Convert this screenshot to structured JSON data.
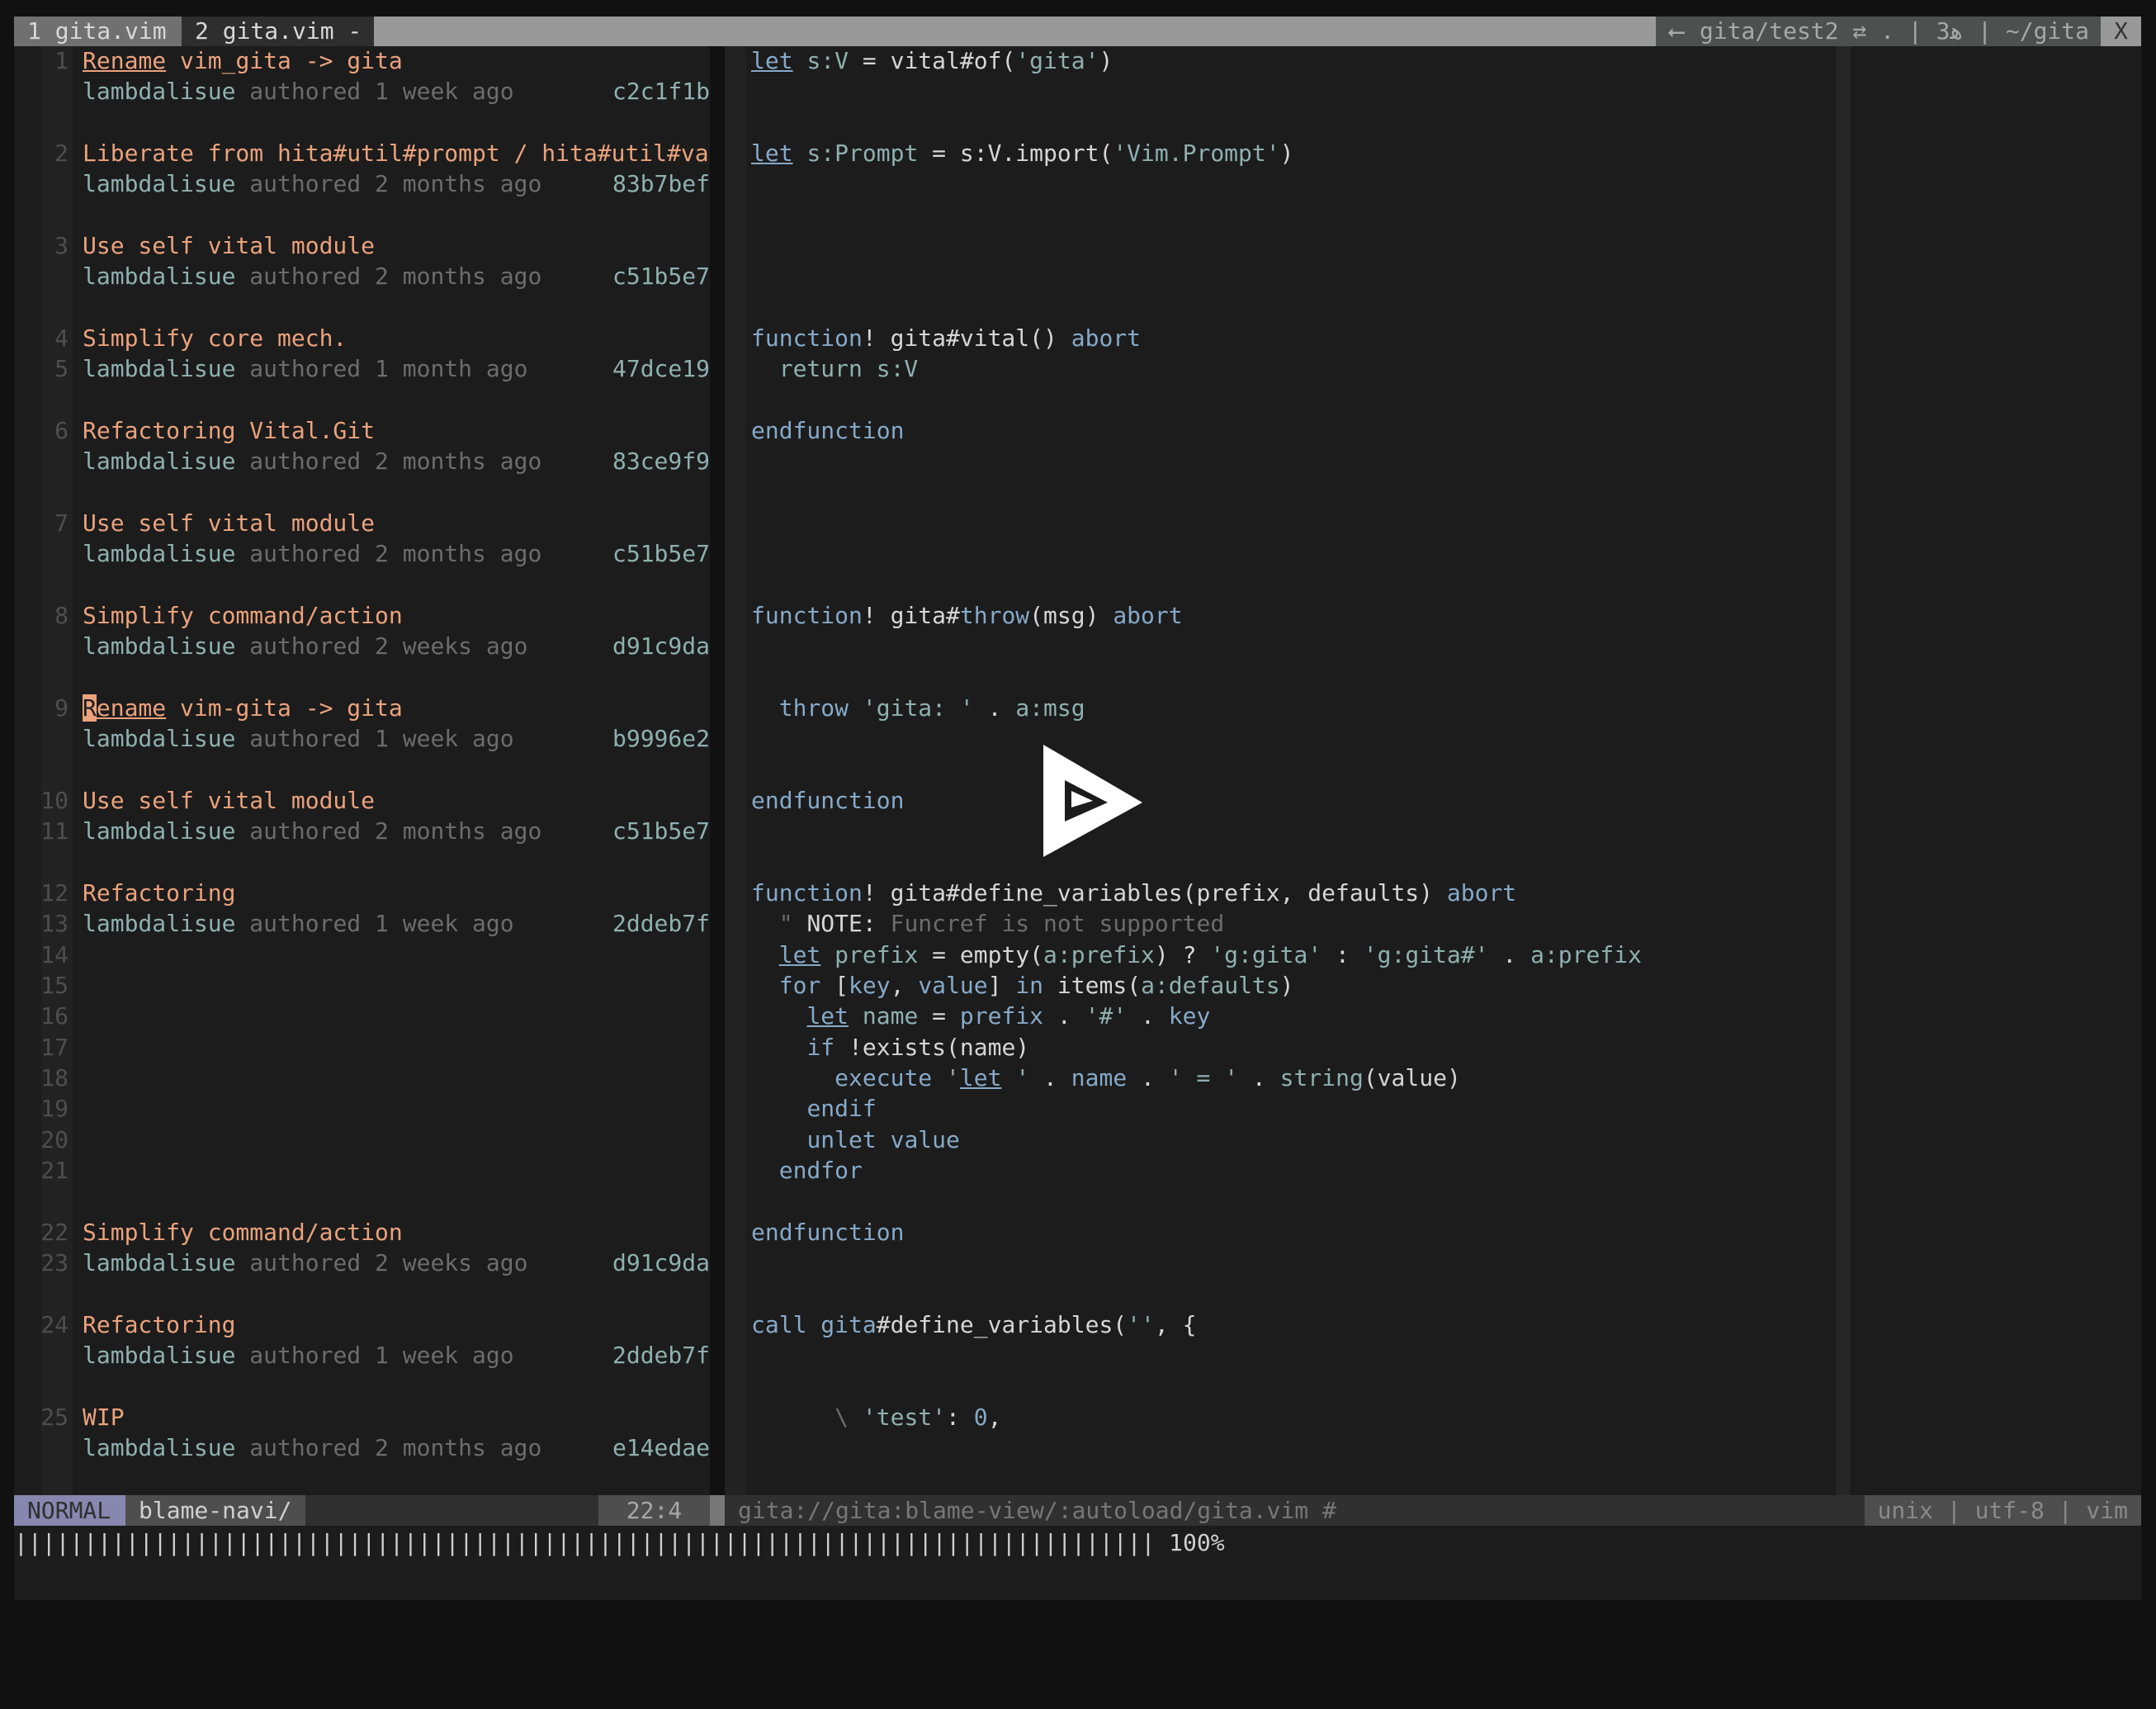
{
  "tabs": [
    {
      "label": "1 gita.vim"
    },
    {
      "label": "2 gita.vim -"
    }
  ],
  "tabline_right": "⭠ gita/test2 ⇄ . | ﻫ3 | ~/gita",
  "tab_close": "X",
  "blame_rows": [
    {
      "row": 0,
      "num": "1",
      "segs": [
        [
          "oru",
          "Rename"
        ],
        [
          "or",
          " vim_gita -> gita"
        ]
      ]
    },
    {
      "row": 1,
      "num": "",
      "segs": [
        [
          "auth",
          "lambdalisue"
        ],
        [
          "gr",
          " authored 1 week ago"
        ]
      ],
      "hash": "c2c1f1b"
    },
    {
      "row": 3,
      "num": "2",
      "segs": [
        [
          "or",
          "Liberate from hita#util#prompt / hita#util#va"
        ]
      ]
    },
    {
      "row": 4,
      "num": "",
      "segs": [
        [
          "auth",
          "lambdalisue"
        ],
        [
          "gr",
          " authored 2 months ago"
        ]
      ],
      "hash": "83b7bef"
    },
    {
      "row": 6,
      "num": "3",
      "segs": [
        [
          "or",
          "Use self vital module"
        ]
      ]
    },
    {
      "row": 7,
      "num": "",
      "segs": [
        [
          "auth",
          "lambdalisue"
        ],
        [
          "gr",
          " authored 2 months ago"
        ]
      ],
      "hash": "c51b5e7"
    },
    {
      "row": 9,
      "num": "4",
      "segs": [
        [
          "or",
          "Simplify core mech."
        ]
      ]
    },
    {
      "row": 10,
      "num": "5",
      "segs": [
        [
          "auth",
          "lambdalisue"
        ],
        [
          "gr",
          " authored 1 month ago"
        ]
      ],
      "hash": "47dce19"
    },
    {
      "row": 12,
      "num": "6",
      "segs": [
        [
          "or",
          "Refactoring Vital.Git"
        ]
      ]
    },
    {
      "row": 13,
      "num": "",
      "segs": [
        [
          "auth",
          "lambdalisue"
        ],
        [
          "gr",
          " authored 2 months ago"
        ]
      ],
      "hash": "83ce9f9"
    },
    {
      "row": 15,
      "num": "7",
      "segs": [
        [
          "or",
          "Use self vital module"
        ]
      ]
    },
    {
      "row": 16,
      "num": "",
      "segs": [
        [
          "auth",
          "lambdalisue"
        ],
        [
          "gr",
          " authored 2 months ago"
        ]
      ],
      "hash": "c51b5e7"
    },
    {
      "row": 18,
      "num": "8",
      "segs": [
        [
          "or",
          "Simplify command/action"
        ]
      ]
    },
    {
      "row": 19,
      "num": "",
      "segs": [
        [
          "auth",
          "lambdalisue"
        ],
        [
          "gr",
          " authored 2 weeks ago"
        ]
      ],
      "hash": "d91c9da"
    },
    {
      "row": 21,
      "num": "9",
      "segs": [
        [
          "cursor",
          "R"
        ],
        [
          "oru",
          "ename"
        ],
        [
          "or",
          " vim-gita -> gita"
        ]
      ]
    },
    {
      "row": 22,
      "num": "",
      "segs": [
        [
          "auth",
          "lambdalisue"
        ],
        [
          "gr",
          " authored 1 week ago"
        ]
      ],
      "hash": "b9996e2"
    },
    {
      "row": 24,
      "num": "10",
      "segs": [
        [
          "or",
          "Use self vital module"
        ]
      ]
    },
    {
      "row": 25,
      "num": "11",
      "segs": [
        [
          "auth",
          "lambdalisue"
        ],
        [
          "gr",
          " authored 2 months ago"
        ]
      ],
      "hash": "c51b5e7"
    },
    {
      "row": 27,
      "num": "12",
      "segs": [
        [
          "or",
          "Refactoring"
        ]
      ]
    },
    {
      "row": 28,
      "num": "13",
      "segs": [
        [
          "auth",
          "lambdalisue"
        ],
        [
          "gr",
          " authored 1 week ago"
        ]
      ],
      "hash": "2ddeb7f"
    },
    {
      "row": 29,
      "num": "14",
      "segs": []
    },
    {
      "row": 30,
      "num": "15",
      "segs": []
    },
    {
      "row": 31,
      "num": "16",
      "segs": []
    },
    {
      "row": 32,
      "num": "17",
      "segs": []
    },
    {
      "row": 33,
      "num": "18",
      "segs": []
    },
    {
      "row": 34,
      "num": "19",
      "segs": []
    },
    {
      "row": 35,
      "num": "20",
      "segs": []
    },
    {
      "row": 36,
      "num": "21",
      "segs": []
    },
    {
      "row": 38,
      "num": "22",
      "segs": [
        [
          "or",
          "Simplify command/action"
        ]
      ]
    },
    {
      "row": 39,
      "num": "23",
      "segs": [
        [
          "auth",
          "lambdalisue"
        ],
        [
          "gr",
          " authored 2 weeks ago"
        ]
      ],
      "hash": "d91c9da"
    },
    {
      "row": 41,
      "num": "24",
      "segs": [
        [
          "or",
          "Refactoring"
        ]
      ]
    },
    {
      "row": 42,
      "num": "",
      "segs": [
        [
          "auth",
          "lambdalisue"
        ],
        [
          "gr",
          " authored 1 week ago"
        ]
      ],
      "hash": "2ddeb7f"
    },
    {
      "row": 44,
      "num": "25",
      "segs": [
        [
          "or",
          "WIP"
        ]
      ]
    },
    {
      "row": 45,
      "num": "",
      "segs": [
        [
          "auth",
          "lambdalisue"
        ],
        [
          "gr",
          " authored 2 months ago"
        ]
      ],
      "hash": "e14edae"
    }
  ],
  "code_rows": [
    {
      "row": 0,
      "segs": [
        [
          "kwu",
          "let"
        ],
        [
          "p",
          " "
        ],
        [
          "id",
          "s:V"
        ],
        [
          "p",
          " = vital#of("
        ],
        [
          "str",
          "'gita'"
        ],
        [
          "p",
          ")"
        ]
      ]
    },
    {
      "row": 3,
      "segs": [
        [
          "kwu",
          "let"
        ],
        [
          "p",
          " "
        ],
        [
          "id",
          "s:Prompt"
        ],
        [
          "p",
          " = s:V.import("
        ],
        [
          "str",
          "'Vim.Prompt'"
        ],
        [
          "p",
          ")"
        ]
      ]
    },
    {
      "row": 9,
      "segs": [
        [
          "kw",
          "function"
        ],
        [
          "p",
          "! gita#vital() "
        ],
        [
          "kw",
          "abort"
        ]
      ]
    },
    {
      "row": 10,
      "segs": [
        [
          "p",
          "  "
        ],
        [
          "id",
          "return s:V"
        ]
      ]
    },
    {
      "row": 12,
      "segs": [
        [
          "kw",
          "endfunction"
        ]
      ]
    },
    {
      "row": 18,
      "segs": [
        [
          "kw",
          "function"
        ],
        [
          "p",
          "! gita#"
        ],
        [
          "kw",
          "throw"
        ],
        [
          "p",
          "(msg) "
        ],
        [
          "kw",
          "abort"
        ]
      ]
    },
    {
      "row": 21,
      "segs": [
        [
          "p",
          "  "
        ],
        [
          "kw",
          "throw"
        ],
        [
          "p",
          " "
        ],
        [
          "str",
          "'gita: '"
        ],
        [
          "p",
          " . "
        ],
        [
          "id",
          "a:msg"
        ]
      ]
    },
    {
      "row": 24,
      "segs": [
        [
          "kw",
          "endfunction"
        ]
      ]
    },
    {
      "row": 27,
      "segs": [
        [
          "kw",
          "function"
        ],
        [
          "p",
          "! gita#define_variables(prefix, defaults) "
        ],
        [
          "kw",
          "abort"
        ]
      ]
    },
    {
      "row": 28,
      "segs": [
        [
          "cm",
          "  \" "
        ],
        [
          "p",
          "NOTE:"
        ],
        [
          "cm",
          " Funcref is not supported"
        ]
      ]
    },
    {
      "row": 29,
      "segs": [
        [
          "p",
          "  "
        ],
        [
          "kwu",
          "let"
        ],
        [
          "id",
          " prefix"
        ],
        [
          "p",
          " = empty("
        ],
        [
          "id",
          "a:prefix"
        ],
        [
          "p",
          ") ? "
        ],
        [
          "str",
          "'g:gita'"
        ],
        [
          "p",
          " : "
        ],
        [
          "str",
          "'g:gita#'"
        ],
        [
          "p",
          " . "
        ],
        [
          "id",
          "a:prefix"
        ]
      ]
    },
    {
      "row": 30,
      "segs": [
        [
          "p",
          "  "
        ],
        [
          "kw",
          "for"
        ],
        [
          "p",
          " ["
        ],
        [
          "kw",
          "key"
        ],
        [
          "p",
          ", "
        ],
        [
          "kw",
          "value"
        ],
        [
          "p",
          "] "
        ],
        [
          "kw",
          "in"
        ],
        [
          "p",
          " items("
        ],
        [
          "id",
          "a:defaults"
        ],
        [
          "p",
          ")"
        ]
      ]
    },
    {
      "row": 31,
      "segs": [
        [
          "p",
          "    "
        ],
        [
          "kwu",
          "let"
        ],
        [
          "id",
          " name"
        ],
        [
          "p",
          " = "
        ],
        [
          "kw",
          "prefix"
        ],
        [
          "p",
          " . "
        ],
        [
          "str",
          "'#'"
        ],
        [
          "p",
          " . "
        ],
        [
          "kw",
          "key"
        ]
      ]
    },
    {
      "row": 32,
      "segs": [
        [
          "p",
          "    "
        ],
        [
          "kw",
          "if"
        ],
        [
          "p",
          " !exists(name)"
        ]
      ]
    },
    {
      "row": 33,
      "segs": [
        [
          "p",
          "      "
        ],
        [
          "kw",
          "execute"
        ],
        [
          "p",
          " "
        ],
        [
          "str",
          "'"
        ],
        [
          "kwu",
          "let"
        ],
        [
          "str",
          " '"
        ],
        [
          "p",
          " . "
        ],
        [
          "kw",
          "name"
        ],
        [
          "p",
          " . "
        ],
        [
          "str",
          "' = '"
        ],
        [
          "p",
          " . "
        ],
        [
          "id",
          "string"
        ],
        [
          "p",
          "(value)"
        ]
      ]
    },
    {
      "row": 34,
      "segs": [
        [
          "p",
          "    "
        ],
        [
          "kw",
          "endif"
        ]
      ]
    },
    {
      "row": 35,
      "segs": [
        [
          "p",
          "    "
        ],
        [
          "kw",
          "unlet value"
        ]
      ]
    },
    {
      "row": 36,
      "segs": [
        [
          "p",
          "  "
        ],
        [
          "kw",
          "endfor"
        ]
      ]
    },
    {
      "row": 38,
      "segs": [
        [
          "kw",
          "endfunction"
        ]
      ]
    },
    {
      "row": 41,
      "segs": [
        [
          "kw",
          "call"
        ],
        [
          "p",
          " "
        ],
        [
          "kw",
          "gita"
        ],
        [
          "p",
          "#define_variables("
        ],
        [
          "str",
          "''"
        ],
        [
          "p",
          ", {"
        ]
      ]
    },
    {
      "row": 44,
      "segs": [
        [
          "p",
          "      "
        ],
        [
          "cm",
          "\\"
        ],
        [
          "p",
          " "
        ],
        [
          "str",
          "'test'"
        ],
        [
          "p",
          ": "
        ],
        [
          "kw",
          "0"
        ],
        [
          "p",
          ","
        ]
      ]
    }
  ],
  "status": {
    "mode": "NORMAL",
    "branch": "blame-navi/",
    "position": "22:4",
    "buffer": "gita://gita:blame-view/:autoload/gita.vim #",
    "fileinfo": "unix | utf-8 | vim"
  },
  "cmdline": {
    "bar": "||||||||||||||||||||||||||||||||||||||||||||||||||||||||||||||||||||||||||||||||||",
    "percent": "100%"
  },
  "progress_percent": 100,
  "colors": {
    "accent_orange": "#eba27c",
    "keyword_blue": "#86a9c8",
    "teal": "#8fb0b0",
    "mode_bg": "#8787b0"
  }
}
